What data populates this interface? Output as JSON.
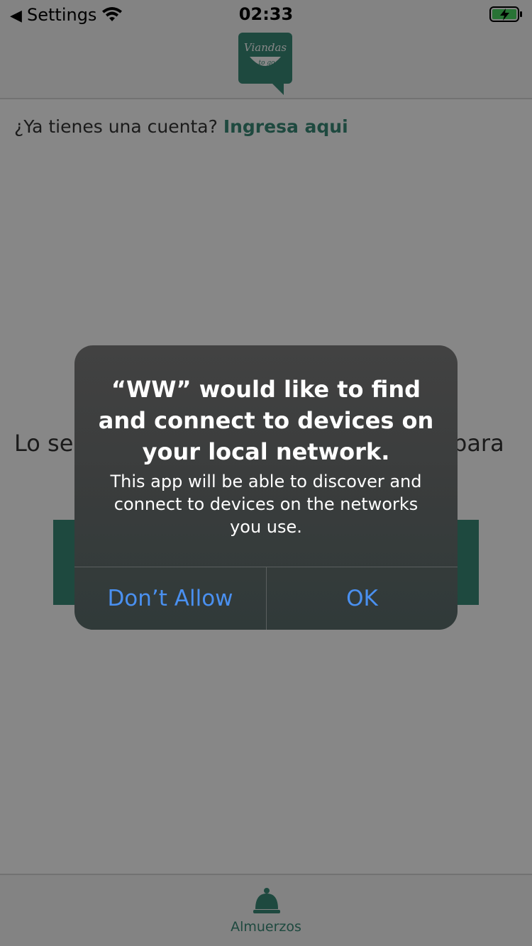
{
  "status_bar": {
    "back_label": "Settings",
    "time": "02:33"
  },
  "logo": {
    "line1": "Viandas",
    "line2": "to go"
  },
  "login": {
    "prompt": "¿Ya tienes una cuenta?",
    "link": "Ingresa aqui"
  },
  "background": {
    "text_left": "Lo se",
    "text_right": "para"
  },
  "tab_bar": {
    "label": "Almuerzos"
  },
  "alert": {
    "title": "“WW” would like to find and connect to devices on your local network.",
    "message": "This app will be able to discover and connect to devices on the networks you use.",
    "dont_allow": "Don’t Allow",
    "ok": "OK"
  },
  "colors": {
    "brand": "#3a8a78",
    "alert_button": "#4a90f0"
  }
}
